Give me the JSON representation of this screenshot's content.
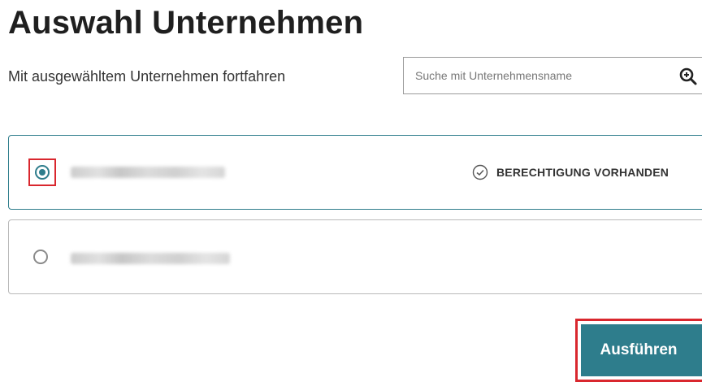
{
  "page": {
    "title": "Auswahl Unternehmen",
    "subtitle": "Mit ausgewähltem Unternehmen fortfahren"
  },
  "search": {
    "placeholder": "Suche mit Unternehmensname",
    "value": "",
    "icon": "search-icon"
  },
  "companies": [
    {
      "name": "",
      "selected": true,
      "status_label": "BERECHTIGUNG VORHANDEN",
      "status_icon": "check-circle-icon"
    },
    {
      "name": "",
      "selected": false,
      "status_label": ""
    }
  ],
  "actions": {
    "execute_label": "Ausführen"
  },
  "colors": {
    "accent": "#2e7d8c",
    "highlight": "#d9272e",
    "border": "#b8b8b8"
  }
}
